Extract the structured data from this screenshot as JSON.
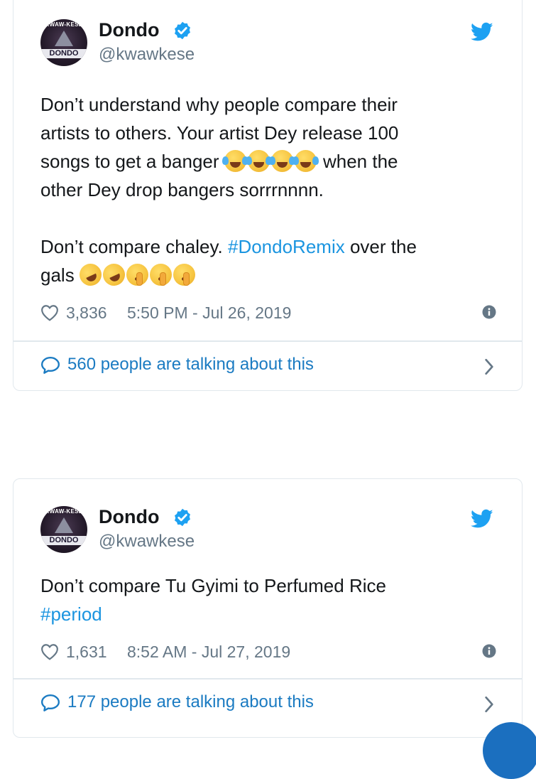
{
  "tweets": [
    {
      "user": {
        "avatar_top_text": "KWAW-KESE",
        "avatar_name_text": "DONDO",
        "name": "Dondo",
        "handle": "@kwawkese",
        "verified": true
      },
      "text": {
        "line1": "Don’t understand why people compare their",
        "line2": "artists to others. Your artist Dey release 100",
        "line3_before": "songs to get a banger ",
        "line3_emoji": "😂😂😂😂",
        "line3_after": " when the",
        "line4": "other Dey drop bangers sorrrnnnn.",
        "line5_before": "Don’t compare chaley. ",
        "line5_hashtag": "#DondoRemix",
        "line5_after": " over the",
        "line6_before": "gals ",
        "line6_emoji": "🤣🤣🤫🤫🤫"
      },
      "likes": "3,836",
      "timestamp": "5:50 PM - Jul 26, 2019",
      "talking": "560 people are talking about this"
    },
    {
      "user": {
        "avatar_top_text": "KWAW-KESE",
        "avatar_name_text": "DONDO",
        "name": "Dondo",
        "handle": "@kwawkese",
        "verified": true
      },
      "text": {
        "line1": "Don’t compare Tu Gyimi to Perfumed Rice",
        "line2_hashtag": "#period"
      },
      "likes": "1,631",
      "timestamp": "8:52 AM - Jul 27, 2019",
      "talking": "177 people are talking about this"
    }
  ],
  "icons": {
    "brand": "twitter-bird-icon",
    "verified": "verified-badge-icon",
    "like": "heart-icon",
    "info": "info-icon",
    "reply": "speech-bubble-icon",
    "expand": "chevron-right-icon"
  },
  "colors": {
    "brand_blue": "#1da1f2",
    "link_blue": "#1b95e0",
    "secondary_text": "#657786",
    "border": "#e1e8ed"
  }
}
